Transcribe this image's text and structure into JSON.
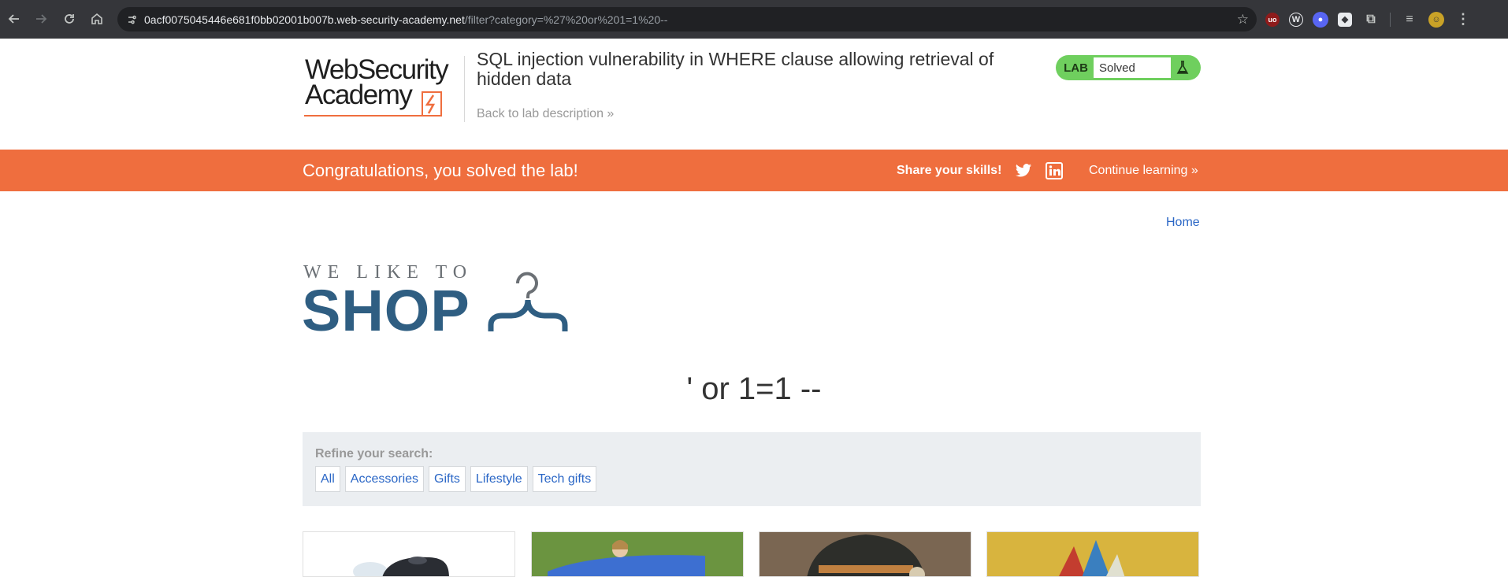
{
  "browser": {
    "url_host": "0acf0075045446e681f0bb02001b007b.web-security-academy.net",
    "url_path": "/filter?category=%27%20or%201=1%20--"
  },
  "lab": {
    "logo_line1": "WebSecurity",
    "logo_line2": "Academy",
    "title": "SQL injection vulnerability in WHERE clause allowing retrieval of hidden data",
    "back_link": "Back to lab description »",
    "tag": "LAB",
    "status": "Solved"
  },
  "banner": {
    "message": "Congratulations, you solved the lab!",
    "share": "Share your skills!",
    "continue": "Continue learning »"
  },
  "shop": {
    "home": "Home",
    "logo_top": "WE LIKE TO",
    "logo_main": "SHOP",
    "heading": "' or 1=1 --",
    "refine_label": "Refine your search:",
    "filters": [
      "All",
      "Accessories",
      "Gifts",
      "Lifestyle",
      "Tech gifts"
    ]
  },
  "colors": {
    "banner": "#ef6e3e",
    "lab_status": "#6fcf5e",
    "shop_blue": "#2f5e82",
    "link": "#2b67c6"
  }
}
